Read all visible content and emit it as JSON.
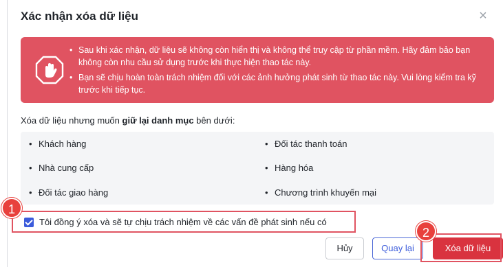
{
  "dialog": {
    "title": "Xác nhận xóa dữ liệu",
    "close_glyph": "×"
  },
  "warning": {
    "icon": "stop-hand-icon",
    "bullets": [
      "Sau khi xác nhận, dữ liệu sẽ không còn hiển thị và không thể truy cập từ phần mềm. Hãy đảm bảo bạn không còn nhu cầu sử dụng trước khi thực hiện thao tác này.",
      "Bạn sẽ chịu hoàn toàn trách nhiệm đối với các ảnh hưởng phát sinh từ thao tác này. Vui lòng kiểm tra kỹ trước khi tiếp tục."
    ]
  },
  "keep": {
    "label_prefix": "Xóa dữ liệu nhưng muốn ",
    "label_bold": "giữ lại danh mục",
    "label_suffix": " bên dưới:",
    "items": [
      "Khách hàng",
      "Đối tác thanh toán",
      "Nhà cung cấp",
      "Hàng hóa",
      "Đối tác giao hàng",
      "Chương trình khuyến mại"
    ]
  },
  "consent": {
    "checked": true,
    "label": "Tôi đồng ý xóa và sẽ tự chịu trách nhiệm về các vấn đề phát sinh nếu có"
  },
  "buttons": {
    "cancel": "Hủy",
    "back": "Quay lại",
    "delete": "Xóa dữ liệu"
  },
  "annotations": {
    "step1": "1",
    "step2": "2"
  },
  "colors": {
    "warning_bg": "#e05361",
    "delete_bg": "#d9333f",
    "accent": "#3b5bdb",
    "badge": "#e8413d"
  }
}
